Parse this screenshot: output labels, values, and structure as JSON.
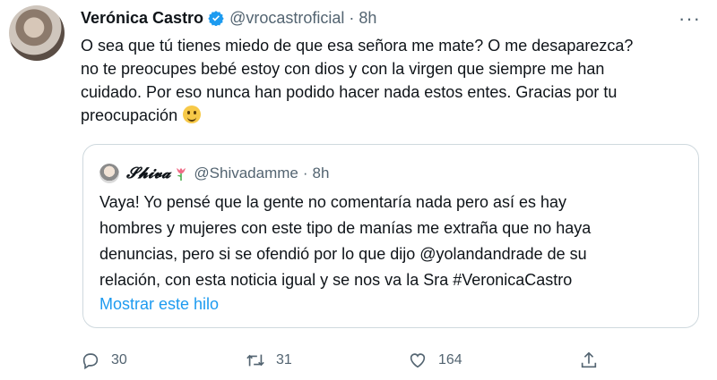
{
  "tweet": {
    "author_name": "Verónica Castro",
    "handle": "@vrocastroficial",
    "separator": "·",
    "time": "8h",
    "text_lines": [
      "O sea que tú tienes miedo de que esa señora me mate? O me desaparezca?",
      "no te preocupes bebé estoy con dios y con la virgen que siempre me han",
      "cuidado. Por eso nunca han podido hacer nada estos entes. Gracias por tu",
      "preocupación"
    ],
    "emoji": "grinning-face-emoji"
  },
  "quote": {
    "author_name": "𝓢𝓱𝓲𝓿𝓪",
    "flower": "tulip-emoji",
    "handle": "@Shivadamme",
    "separator": "·",
    "time": "8h",
    "text_lines": [
      "Vaya! Yo pensé que la gente no comentaría nada pero así es hay",
      "hombres y mujeres con este tipo de manías me extraña que no haya",
      "denuncias, pero si se ofendió por lo que dijo @yolandandrade de su",
      "relación, con esta noticia igual y se nos va la Sra #VeronicaCastro"
    ],
    "show_thread": "Mostrar este hilo"
  },
  "actions": {
    "replies": "30",
    "retweets": "31",
    "likes": "164"
  },
  "colors": {
    "verified": "#1d9bf0",
    "link": "#1d9bf0",
    "secondary_text": "#536471",
    "border": "#cfd9de"
  }
}
